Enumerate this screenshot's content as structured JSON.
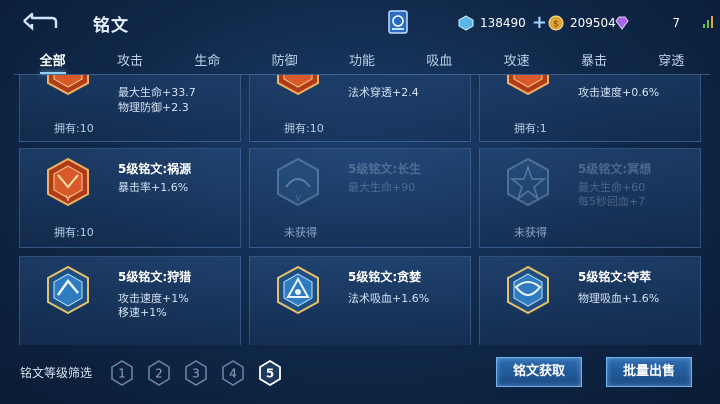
{
  "header": {
    "title": "铭文",
    "currencies": [
      {
        "icon": "diamond-coupon-icon",
        "value": "138490",
        "has_plus": true
      },
      {
        "icon": "gold-coin-icon",
        "value": "209504",
        "has_plus": false
      },
      {
        "icon": "purple-gem-icon",
        "value": "7",
        "has_plus": false
      }
    ]
  },
  "tabs": [
    "全部",
    "攻击",
    "生命",
    "防御",
    "功能",
    "吸血",
    "攻速",
    "暴击",
    "穿透"
  ],
  "active_tab": "全部",
  "cards": [
    {
      "name": "",
      "attrs": [
        "最大生命+33.7",
        "物理防御+2.3"
      ],
      "owned": "拥有:10",
      "color": "red",
      "locked": false
    },
    {
      "name": "",
      "attrs": [
        "法术穿透+2.4"
      ],
      "owned": "拥有:10",
      "color": "red",
      "locked": false
    },
    {
      "name": "",
      "attrs": [
        "攻击速度+0.6%"
      ],
      "owned": "拥有:1",
      "color": "red",
      "locked": false
    },
    {
      "name": "5级铭文:祸源",
      "attrs": [
        "暴击率+1.6%"
      ],
      "owned": "拥有:10",
      "color": "red",
      "locked": false
    },
    {
      "name": "5级铭文:长生",
      "attrs": [
        "最大生命+90"
      ],
      "owned": "未获得",
      "color": "blue",
      "locked": true
    },
    {
      "name": "5级铭文:冥想",
      "attrs": [
        "最大生命+60",
        "每5秒回血+7"
      ],
      "owned": "未获得",
      "color": "blue",
      "locked": true
    },
    {
      "name": "5级铭文:狩猎",
      "attrs": [
        "攻击速度+1%",
        "移速+1%"
      ],
      "owned": "",
      "color": "blue",
      "locked": false
    },
    {
      "name": "5级铭文:贪婪",
      "attrs": [
        "法术吸血+1.6%"
      ],
      "owned": "",
      "color": "blue",
      "locked": false
    },
    {
      "name": "5级铭文:夺萃",
      "attrs": [
        "物理吸血+1.6%"
      ],
      "owned": "",
      "color": "blue",
      "locked": false
    }
  ],
  "filter": {
    "label": "铭文等级筛选",
    "levels": [
      "1",
      "2",
      "3",
      "4",
      "5"
    ],
    "selected": "5"
  },
  "actions": {
    "obtain_label": "铭文获取",
    "sell_label": "批量出售"
  },
  "colors": {
    "accent": "#8fd0ff",
    "red_emblem": "#c8461f",
    "blue_emblem": "#3a8fd0"
  }
}
